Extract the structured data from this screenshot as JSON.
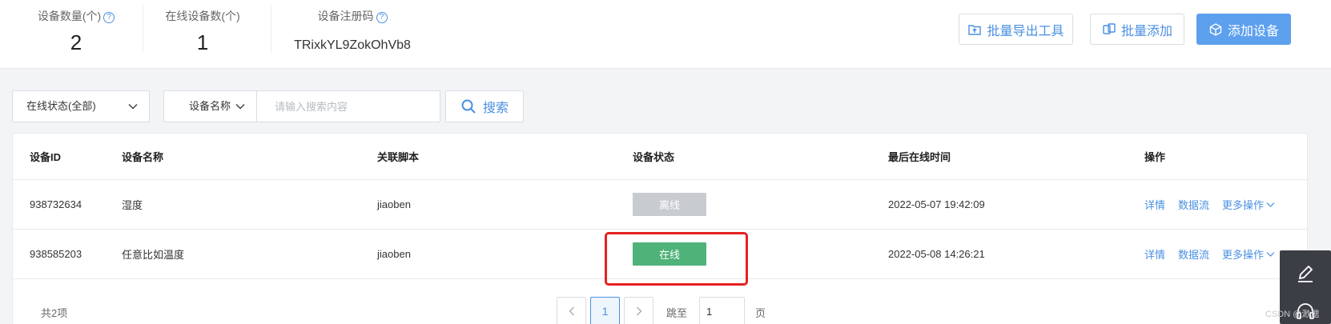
{
  "stats": {
    "device_count_label": "设备数量(个)",
    "device_count_value": "2",
    "online_count_label": "在线设备数(个)",
    "online_count_value": "1",
    "reg_code_label": "设备注册码",
    "reg_code_value": "TRixkYL9ZokOhVb8",
    "help_glyph": "?"
  },
  "toolbar": {
    "export_label": "批量导出工具",
    "batch_add_label": "批量添加",
    "add_device_label": "添加设备"
  },
  "filters": {
    "status_select": "在线状态(全部)",
    "search_type": "设备名称",
    "search_placeholder": "请输入搜索内容",
    "search_button": "搜索"
  },
  "table": {
    "headers": [
      "设备ID",
      "设备名称",
      "关联脚本",
      "设备状态",
      "最后在线时间",
      "操作"
    ],
    "rows": [
      {
        "id": "938732634",
        "name": "湿度",
        "script": "jiaoben",
        "status": "离线",
        "status_color": "#c8cbcf",
        "last_online": "2022-05-07 19:42:09"
      },
      {
        "id": "938585203",
        "name": "任意比如温度",
        "script": "jiaoben",
        "status": "在线",
        "status_color": "#4fb279",
        "last_online": "2022-05-08 14:26:21"
      }
    ],
    "actions": {
      "detail": "详情",
      "data_stream": "数据流",
      "more": "更多操作"
    }
  },
  "pagination": {
    "total": "共2项",
    "current_page": "1",
    "jump_label": "跳至",
    "jump_value": "1",
    "page_suffix": "页"
  },
  "watermark": "CSDN @渺邈",
  "colors": {
    "accent": "#4a90e2",
    "primary_button": "#5ca0ee",
    "highlight": "#e62121",
    "dock": "#3b3e45"
  },
  "icons": {
    "export": "folder-upload-icon",
    "batch_add": "copy-icon",
    "add_device": "cube-icon",
    "search": "search-icon",
    "dropdown": "chevron-down-icon",
    "dock_top": "edit-icon",
    "dock_bottom": "headset-icon"
  }
}
